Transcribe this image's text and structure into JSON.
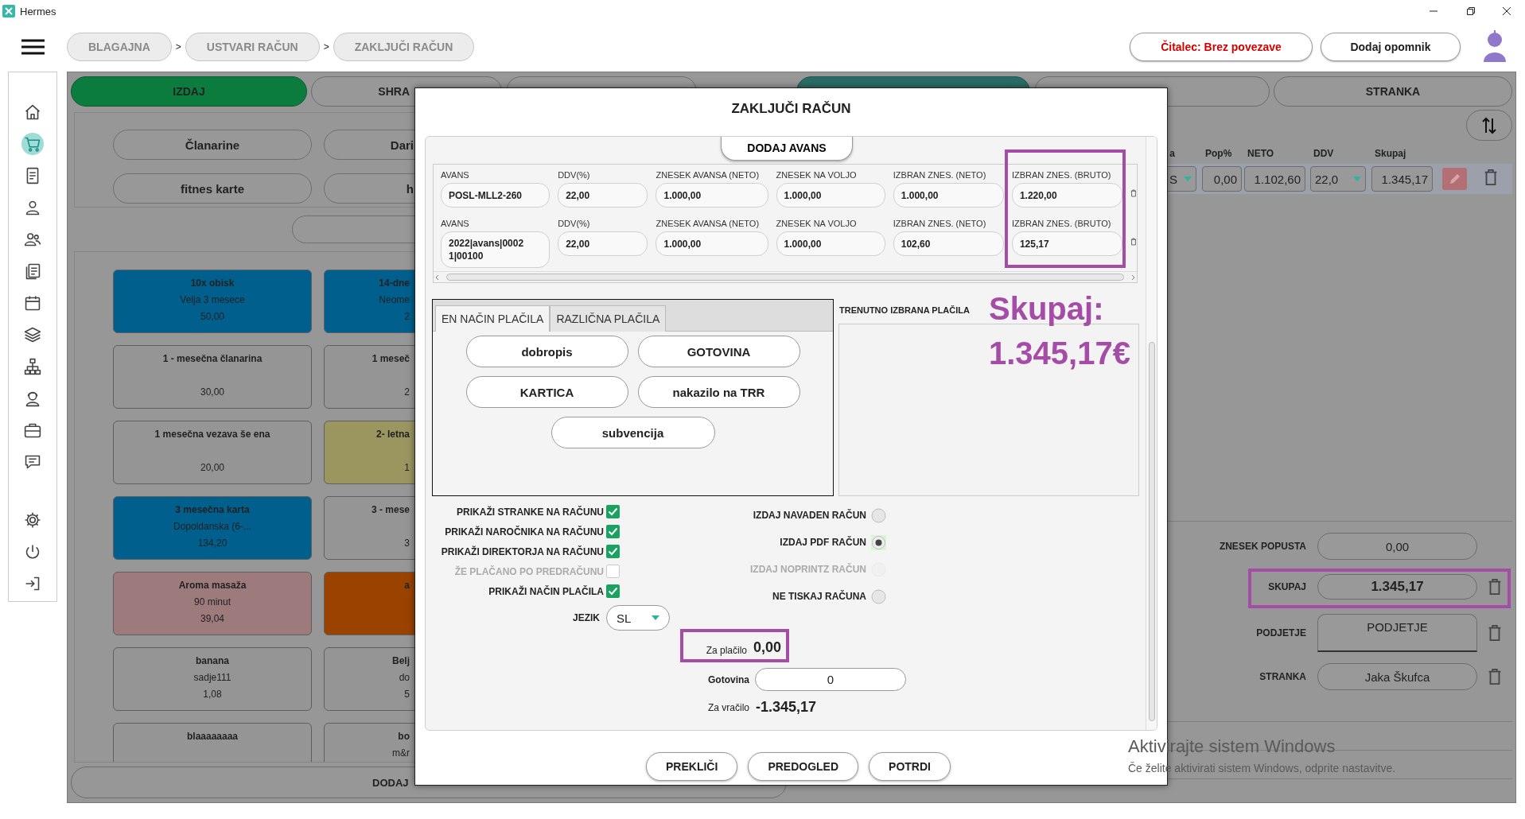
{
  "window": {
    "title": "Hermes"
  },
  "breadcrumbs": [
    {
      "label": "BLAGAJNA",
      "separator": ">"
    },
    {
      "label": "USTVARI RAČUN",
      "separator": ">"
    },
    {
      "label": "ZAKLJUČI RAČUN"
    }
  ],
  "header_buttons": [
    {
      "label": "Čitalec: Brez povezave",
      "kind": "alert"
    },
    {
      "label": "Dodaj opomnik",
      "kind": "normal"
    }
  ],
  "sidebar": {
    "items": [
      {
        "kind": "home",
        "selected": false
      },
      {
        "kind": "cart",
        "selected": true
      },
      {
        "kind": "document",
        "selected": false
      },
      {
        "kind": "person",
        "selected": false
      },
      {
        "kind": "people",
        "selected": false
      },
      {
        "kind": "documents",
        "selected": false
      },
      {
        "kind": "calendar",
        "selected": false
      },
      {
        "kind": "layers",
        "selected": false
      },
      {
        "kind": "sitemap",
        "selected": false
      },
      {
        "kind": "support",
        "selected": false
      },
      {
        "kind": "briefcase",
        "selected": false
      },
      {
        "kind": "chat",
        "selected": false
      }
    ],
    "bottom_items": [
      {
        "kind": "settings",
        "selected": false
      },
      {
        "kind": "power",
        "selected": false
      },
      {
        "kind": "logout",
        "selected": false
      }
    ]
  },
  "sale_panel": {
    "tabs": [
      {
        "label": "IZDAJ",
        "selected": true
      },
      {
        "label": "SHRA",
        "selected": false
      },
      {
        "selected": false
      }
    ],
    "categories": [
      {
        "label": "Članarine"
      },
      {
        "label": "Dari"
      },
      {
        "label": "fitnes karte"
      },
      {
        "label": "h"
      }
    ],
    "products": [
      {
        "name": "10x obisk",
        "description": "Velja 3 mesece",
        "price": "50,00",
        "color": "#005f8c"
      },
      {
        "name": "14-dne",
        "description": "Neome",
        "price": "2",
        "color": "#005f8c"
      },
      {
        "name": "1 - mesečna članarina",
        "price": "30,00",
        "color": "#959595"
      },
      {
        "name": "1 meseč",
        "price": "2",
        "color": "#959595"
      },
      {
        "name": "1 mesečna vezava še ena",
        "price": "20,00",
        "color": "#959595"
      },
      {
        "name": "2- letna",
        "price": "1",
        "color": "#9b9660"
      },
      {
        "name": "3 mesečna karta",
        "description": "Dopoldanska (6-...",
        "price": "134,20",
        "color": "#005f8c"
      },
      {
        "name": "3 - mese",
        "price": "3",
        "color": "#959595"
      },
      {
        "name": "Aroma masaža",
        "description": "90 minut",
        "price": "39,04",
        "color": "#9d7b7d"
      },
      {
        "name": "a",
        "color": "#9a4300"
      },
      {
        "name": "banana",
        "description": "sadje111",
        "price": "1,08",
        "color": "#959595"
      },
      {
        "name": "Belj",
        "description": "do",
        "price": "5",
        "color": "#959595"
      },
      {
        "name": "blaaaaaaaa",
        "color": "#959595"
      },
      {
        "name": "bo",
        "description": "m&r",
        "color": "#959595"
      }
    ],
    "add_product_button": "DODAJ"
  },
  "invoice_panel": {
    "tabs": [
      {
        "selected": true
      },
      {
        "selected": false
      },
      {
        "label": "STRANKA",
        "selected": false
      }
    ],
    "columns": [
      "a",
      "Pop%",
      "NETO",
      "DDV",
      "Skupaj"
    ],
    "row": {
      "unit": "S",
      "discount": "0,00",
      "net": "1.102,60",
      "vat": "22,0",
      "total": "1.345,17"
    },
    "summary": [
      {
        "label": "ZNESEK POPUSTA",
        "value": "0,00",
        "kind": "plain",
        "deletable": false
      },
      {
        "label": "SKUPAJ",
        "value": "1.345,17",
        "kind": "total",
        "deletable": true
      },
      {
        "label": "PODJETJE",
        "value": "PODJETJE",
        "kind": "tall",
        "deletable": true
      },
      {
        "label": "STRANKA",
        "value": "Jaka Škufca",
        "kind": "plain",
        "deletable": true
      }
    ]
  },
  "modal": {
    "title": "ZAKLJUČI RAČUN",
    "add_advance_button": "DODAJ AVANS",
    "advances": [
      {
        "fields": [
          {
            "label": "AVANS",
            "value": "POSL-MLL2-260"
          },
          {
            "label": "DDV(%)",
            "value": "22,00"
          },
          {
            "label": "ZNESEK AVANSA (NETO)",
            "value": "1.000,00"
          },
          {
            "label": "ZNESEK NA VOLJO",
            "value": "1.000,00"
          },
          {
            "label": "IZBRAN ZNES. (NETO)",
            "value": "1.000,00"
          },
          {
            "label": "IZBRAN ZNES. (BRUTO)",
            "value": "1.220,00"
          }
        ]
      },
      {
        "fields": [
          {
            "label": "AVANS",
            "value": "2022|avans|0002 1|00100"
          },
          {
            "label": "DDV(%)",
            "value": "22,00"
          },
          {
            "label": "ZNESEK AVANSA (NETO)",
            "value": "1.000,00"
          },
          {
            "label": "ZNESEK NA VOLJO",
            "value": "1.000,00"
          },
          {
            "label": "IZBRAN ZNES. (NETO)",
            "value": "102,60"
          },
          {
            "label": "IZBRAN ZNES. (BRUTO)",
            "value": "125,17"
          }
        ]
      }
    ],
    "payment_tabs": [
      {
        "label": "EN NAČIN PLAČILA",
        "selected": true
      },
      {
        "label": "RAZLIČNA PLAČILA",
        "selected": false
      }
    ],
    "payment_methods": [
      "dobropis",
      "GOTOVINA",
      "KARTICA",
      "nakazilo na TRR",
      "subvencija"
    ],
    "selected_payments_label": "TRENUTNO IZBRANA PLAČILA",
    "options": [
      {
        "label": "PRIKAŽI STRANKE NA RAČUNU",
        "checked": true,
        "disabled": false
      },
      {
        "label": "PRIKAŽI NAROČNIKA NA RAČUNU",
        "checked": true,
        "disabled": false
      },
      {
        "label": "PRIKAŽI DIREKTORJA NA RAČUNU",
        "checked": true,
        "disabled": false
      },
      {
        "label": "ŽE PLAČANO PO PREDRAČUNU",
        "checked": false,
        "disabled": true
      },
      {
        "label": "PRIKAŽI NAČIN PLAČILA",
        "checked": true,
        "disabled": false
      }
    ],
    "language": {
      "label": "JEZIK",
      "value": "SL"
    },
    "print_modes": [
      {
        "label": "IZDAJ NAVADEN RAČUN",
        "selected": false,
        "disabled": false
      },
      {
        "label": "IZDAJ PDF RAČUN",
        "selected": true,
        "disabled": false
      },
      {
        "label": "IZDAJ NOPRINTZ RAČUN",
        "selected": false,
        "disabled": true
      },
      {
        "label": "NE TISKAJ RAČUNA",
        "selected": false,
        "disabled": false
      }
    ],
    "to_pay": {
      "label": "Za plačilo",
      "value": "0,00"
    },
    "cash": {
      "label": "Gotovina",
      "value": "0"
    },
    "change": {
      "label": "Za vračilo",
      "value": "-1.345,17"
    },
    "buttons": [
      "PREKLIČI",
      "PREDOGLED",
      "POTRDI"
    ]
  },
  "annotation": {
    "lines": [
      "Skupaj:",
      "1.345,17€"
    ]
  },
  "system_notice": {
    "title": "Aktivirajte sistem Windows",
    "hint": "Če želite aktivirati sistem Windows, odprite nastavitve."
  }
}
